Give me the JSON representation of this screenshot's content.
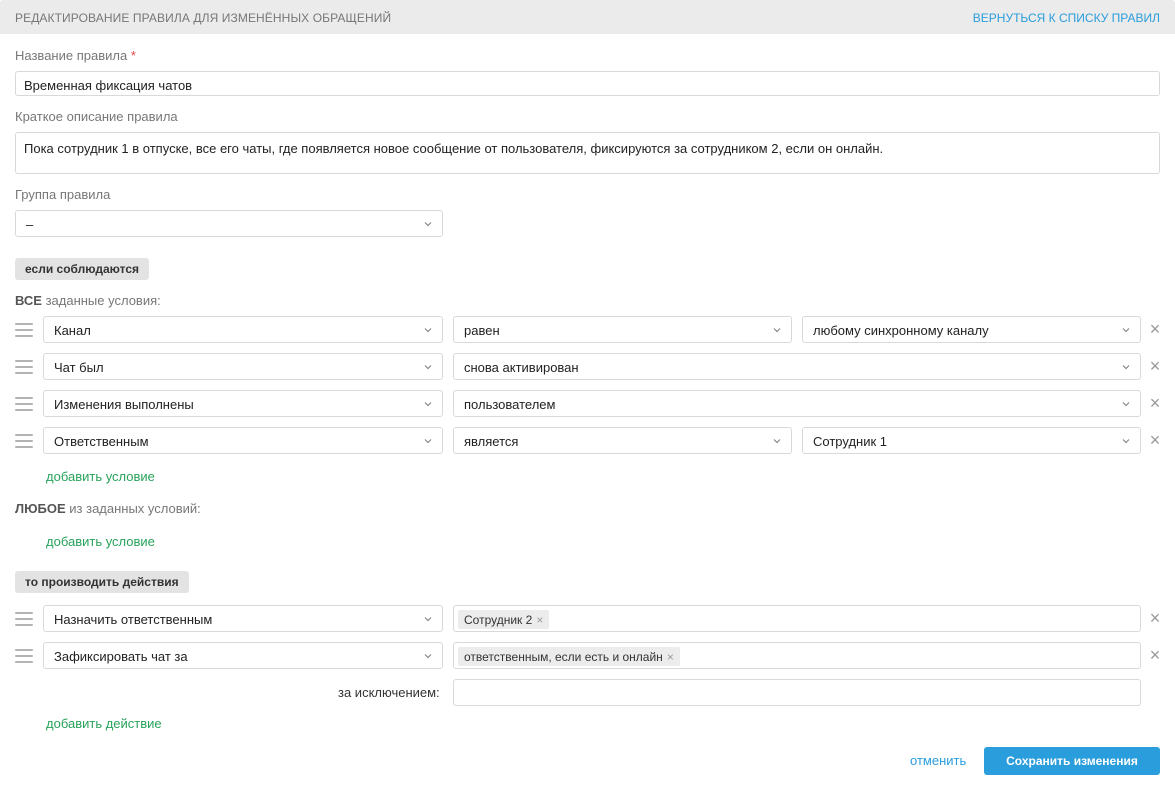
{
  "header": {
    "title": "РЕДАКТИРОВАНИЕ ПРАВИЛА ДЛЯ ИЗМЕНЁННЫХ ОБРАЩЕНИЙ",
    "back_link": "ВЕРНУТЬСЯ К СПИСКУ ПРАВИЛ"
  },
  "form": {
    "name_label": "Название правила",
    "required_mark": "*",
    "name_value": "Временная фиксация чатов",
    "desc_label": "Краткое описание правила",
    "desc_value": "Пока сотрудник 1 в отпуске, все его чаты, где появляется новое сообщение от пользователя, фиксируются за сотрудником 2, если он онлайн.",
    "group_label": "Группа правила",
    "group_value": "–"
  },
  "conditions": {
    "section_label": "если соблюдаются",
    "all_prefix": "ВСЕ",
    "all_suffix": " заданные условия:",
    "rows": [
      {
        "field": "Канал",
        "op": "равен",
        "value": "любому синхронному каналу"
      },
      {
        "field": "Чат был",
        "op": "снова активирован"
      },
      {
        "field": "Изменения выполнены",
        "op": "пользователем"
      },
      {
        "field": "Ответственным",
        "op": "является",
        "value": "Сотрудник 1"
      }
    ],
    "add_condition_1": "добавить условие",
    "any_prefix": "ЛЮБОЕ",
    "any_suffix": " из заданных условий:",
    "add_condition_2": "добавить условие"
  },
  "actions": {
    "section_label": "то производить действия",
    "rows": [
      {
        "action": "Назначить ответственным",
        "tag": "Сотрудник 2"
      },
      {
        "action": "Зафиксировать чат за",
        "tag": "ответственным, если есть и онлайн"
      }
    ],
    "except_label": "за исключением:",
    "except_value": "",
    "add_action": "добавить действие"
  },
  "footer": {
    "cancel": "отменить",
    "save": "Сохранить изменения"
  },
  "colors": {
    "accent": "#2a9ddc",
    "link_green": "#27a35a",
    "required": "#e04848"
  }
}
